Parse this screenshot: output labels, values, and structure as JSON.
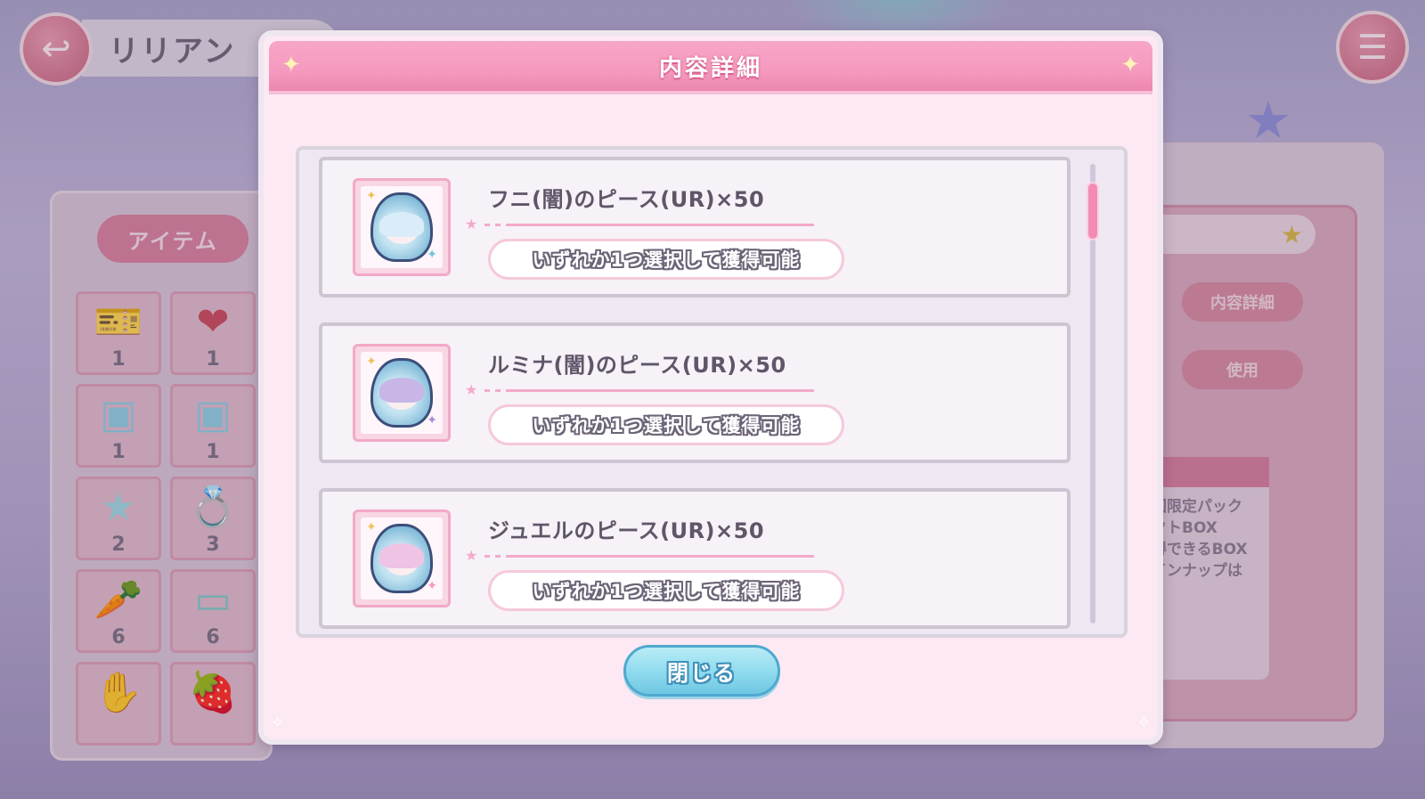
{
  "background": {
    "screen_title": "リリアン",
    "item_tab_label": "アイテム",
    "inventory_counts": [
      "1",
      "1",
      "1",
      "1",
      "2",
      "3",
      "6",
      "6"
    ],
    "right_buttons": [
      "内容詳細",
      "使用"
    ],
    "right_desc_lines": [
      "回限定パック",
      "クトBOX",
      "得できるBOX",
      "インナップは"
    ]
  },
  "dialog": {
    "title": "内容詳細",
    "items": [
      {
        "name": "フニ(闇)のピース(UR)×50",
        "note": "いずれか1つ選択して獲得可能"
      },
      {
        "name": "ルミナ(闇)のピース(UR)×50",
        "note": "いずれか1つ選択して獲得可能"
      },
      {
        "name": "ジュエルのピース(UR)×50",
        "note": "いずれか1つ選択して獲得可能"
      }
    ],
    "close_label": "閉じる"
  },
  "colors": {
    "header_pink": "#f59abf",
    "close_blue": "#8edaee",
    "scroll_thumb": "#f38bb5"
  },
  "icons": [
    "back-arrow-icon",
    "menu-list-icon",
    "sparkle-icon",
    "star-icon"
  ]
}
